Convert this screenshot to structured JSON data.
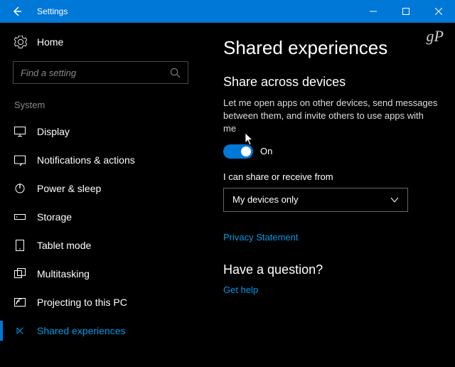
{
  "titlebar": {
    "title": "Settings"
  },
  "sidebar": {
    "home_label": "Home",
    "search_placeholder": "Find a setting",
    "group_header": "System",
    "items": [
      {
        "label": "Display"
      },
      {
        "label": "Notifications & actions"
      },
      {
        "label": "Power & sleep"
      },
      {
        "label": "Storage"
      },
      {
        "label": "Tablet mode"
      },
      {
        "label": "Multitasking"
      },
      {
        "label": "Projecting to this PC"
      },
      {
        "label": "Shared experiences"
      }
    ]
  },
  "main": {
    "page_title": "Shared experiences",
    "section1_title": "Share across devices",
    "section1_desc": "Let me open apps on other devices, send messages between them, and invite others to use apps with me",
    "toggle_state": "On",
    "dropdown_label": "I can share or receive from",
    "dropdown_value": "My devices only",
    "privacy_link": "Privacy Statement",
    "question_title": "Have a question?",
    "help_link": "Get help"
  },
  "watermark": "gP"
}
